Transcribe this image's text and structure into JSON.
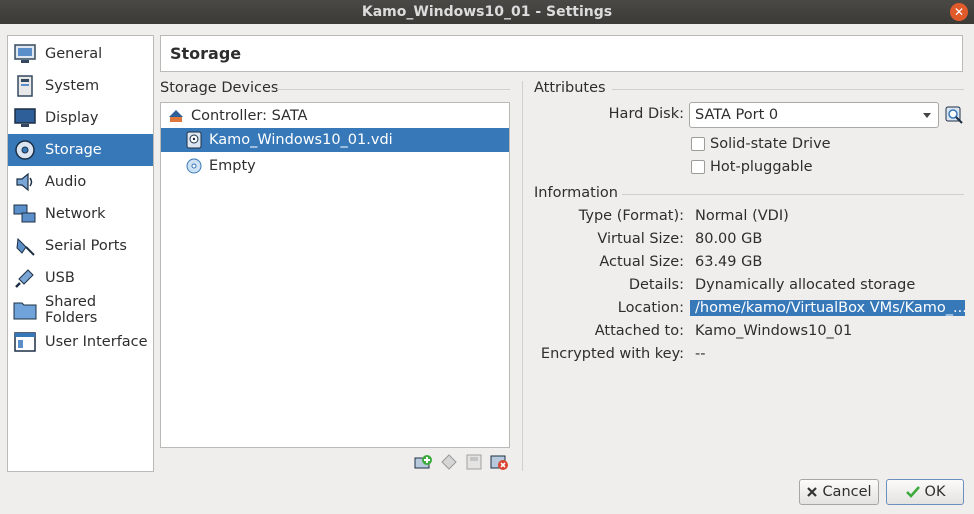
{
  "window": {
    "title": "Kamo_Windows10_01 - Settings"
  },
  "sidebar": {
    "items": [
      {
        "label": "General",
        "icon": "general-icon"
      },
      {
        "label": "System",
        "icon": "system-icon"
      },
      {
        "label": "Display",
        "icon": "display-icon"
      },
      {
        "label": "Storage",
        "icon": "storage-icon",
        "active": true
      },
      {
        "label": "Audio",
        "icon": "audio-icon"
      },
      {
        "label": "Network",
        "icon": "network-icon"
      },
      {
        "label": "Serial Ports",
        "icon": "serial-ports-icon"
      },
      {
        "label": "USB",
        "icon": "usb-icon"
      },
      {
        "label": "Shared Folders",
        "icon": "shared-folders-icon"
      },
      {
        "label": "User Interface",
        "icon": "user-interface-icon"
      }
    ]
  },
  "page": {
    "title": "Storage"
  },
  "storage_devices": {
    "label": "Storage Devices",
    "tree": [
      {
        "label": "Controller: SATA",
        "type": "controller"
      },
      {
        "label": "Kamo_Windows10_01.vdi",
        "type": "hard-disk",
        "selected": true
      },
      {
        "label": "Empty",
        "type": "optical"
      }
    ]
  },
  "attributes": {
    "label": "Attributes",
    "hard_disk_label": "Hard Disk:",
    "hard_disk_value": "SATA Port 0",
    "solid_state_label": "Solid-state Drive",
    "hot_pluggable_label": "Hot-pluggable"
  },
  "information": {
    "label": "Information",
    "rows": [
      {
        "key": "Type (Format):",
        "value": "Normal (VDI)"
      },
      {
        "key": "Virtual Size:",
        "value": "80.00 GB"
      },
      {
        "key": "Actual Size:",
        "value": "63.49 GB"
      },
      {
        "key": "Details:",
        "value": "Dynamically allocated storage"
      },
      {
        "key": "Location:",
        "value": "/home/kamo/VirtualBox VMs/Kamo_...",
        "highlight": true
      },
      {
        "key": "Attached to:",
        "value": "Kamo_Windows10_01"
      },
      {
        "key": "Encrypted with key:",
        "value": "--"
      }
    ]
  },
  "buttons": {
    "cancel": "Cancel",
    "ok": "OK"
  },
  "colors": {
    "accent": "#3778b8",
    "titlebar": "#3b3a37",
    "close": "#e05a2a"
  }
}
